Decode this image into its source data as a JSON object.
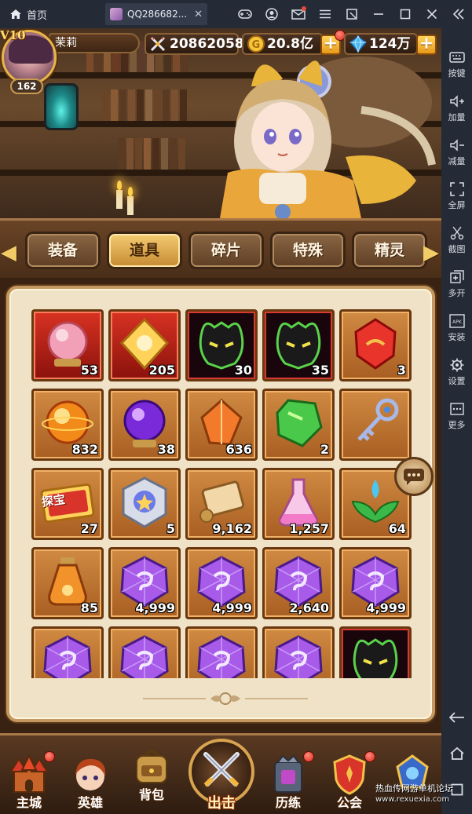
{
  "emulator": {
    "home_label": "首页",
    "tab_title": "QQ286682...",
    "tab_close": "✕",
    "titlebar_icons": [
      "gamepad-icon",
      "user-icon",
      "mail-icon",
      "menu-icon",
      "popout-icon",
      "minimize-icon",
      "maximize-icon",
      "close-icon",
      "collapse-icon"
    ],
    "sidebar": [
      {
        "label": "按键",
        "icon": "keyboard-icon"
      },
      {
        "label": "加量",
        "icon": "volume-up-icon"
      },
      {
        "label": "减量",
        "icon": "volume-down-icon"
      },
      {
        "label": "全屏",
        "icon": "fullscreen-icon"
      },
      {
        "label": "截图",
        "icon": "scissors-icon"
      },
      {
        "label": "多开",
        "icon": "multi-instance-icon"
      },
      {
        "label": "安装",
        "icon": "apk-icon"
      },
      {
        "label": "设置",
        "icon": "gear-icon"
      },
      {
        "label": "更多",
        "icon": "more-icon"
      }
    ],
    "nav_buttons": [
      "back-icon",
      "home-icon",
      "recent-apps-icon"
    ]
  },
  "player": {
    "vip": "V10",
    "level": "162",
    "name": "茉莉",
    "power": "20862058",
    "gold": "20.8亿",
    "diamonds": "124万"
  },
  "tabs": [
    {
      "label": "装备",
      "active": false
    },
    {
      "label": "道具",
      "active": true
    },
    {
      "label": "碎片",
      "active": false
    },
    {
      "label": "特殊",
      "active": false
    },
    {
      "label": "精灵",
      "active": false
    }
  ],
  "items": [
    {
      "icon": "crystal-orb-icon",
      "qty": "53",
      "frame": "red"
    },
    {
      "icon": "golden-crystal-icon",
      "qty": "205",
      "frame": "red"
    },
    {
      "icon": "demon-mask-icon",
      "qty": "30",
      "frame": "dark"
    },
    {
      "icon": "demon-mask-icon",
      "qty": "35",
      "frame": "dark"
    },
    {
      "icon": "red-gem-icon",
      "qty": "3",
      "frame": "orange"
    },
    {
      "icon": "fire-orb-icon",
      "qty": "832",
      "frame": "orange"
    },
    {
      "icon": "purple-orb-icon",
      "qty": "38",
      "frame": "orange"
    },
    {
      "icon": "orange-crystal-icon",
      "qty": "636",
      "frame": "orange"
    },
    {
      "icon": "green-gem-icon",
      "qty": "2",
      "frame": "orange"
    },
    {
      "icon": "key-icon",
      "qty": "",
      "frame": "orange"
    },
    {
      "icon": "treasure-ticket-icon",
      "qty": "27",
      "frame": "orange",
      "label": "探宝"
    },
    {
      "icon": "silver-medal-icon",
      "qty": "5",
      "frame": "orange"
    },
    {
      "icon": "scroll-icon",
      "qty": "9,162",
      "frame": "orange"
    },
    {
      "icon": "potion-flask-icon",
      "qty": "1,257",
      "frame": "orange"
    },
    {
      "icon": "water-sprout-icon",
      "qty": "64",
      "frame": "orange"
    },
    {
      "icon": "elixir-bottle-icon",
      "qty": "85",
      "frame": "orange"
    },
    {
      "icon": "purple-rune-icon",
      "qty": "4,999",
      "frame": "orange"
    },
    {
      "icon": "purple-rune-icon",
      "qty": "4,999",
      "frame": "orange"
    },
    {
      "icon": "purple-rune-icon",
      "qty": "2,640",
      "frame": "orange"
    },
    {
      "icon": "purple-rune-icon",
      "qty": "4,999",
      "frame": "orange"
    },
    {
      "icon": "purple-rune-icon",
      "qty": "",
      "frame": "orange"
    },
    {
      "icon": "purple-rune-icon",
      "qty": "",
      "frame": "orange"
    },
    {
      "icon": "purple-rune-icon",
      "qty": "",
      "frame": "orange"
    },
    {
      "icon": "purple-rune-icon",
      "qty": "",
      "frame": "orange"
    },
    {
      "icon": "demon-mask-icon",
      "qty": "",
      "frame": "dark"
    }
  ],
  "bottom_nav": [
    {
      "label": "主城",
      "icon": "castle-icon",
      "badge": true
    },
    {
      "label": "英雄",
      "icon": "hero-icon",
      "badge": false
    },
    {
      "label": "背包",
      "icon": "backpack-icon",
      "badge": false
    },
    {
      "label": "出击",
      "icon": "crossed-swords-icon",
      "badge": false
    },
    {
      "label": "历练",
      "icon": "trial-icon",
      "badge": true
    },
    {
      "label": "公会",
      "icon": "guild-icon",
      "badge": true
    },
    {
      "label": "",
      "icon": "crest-icon",
      "badge": false
    }
  ],
  "watermark": {
    "text": "热血传网游单机论坛",
    "url": "www.rexuexia.com"
  }
}
